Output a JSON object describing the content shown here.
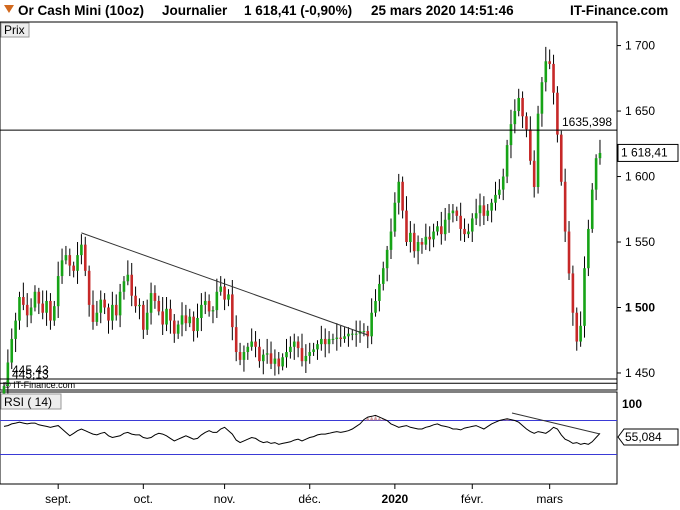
{
  "header": {
    "instrument": "Or Cash Mini (10oz)",
    "period": "Journalier",
    "quote": "1 618,41 (-0,90%)",
    "datetime": "25 mars 2020 14:51:46",
    "site": "IT-Finance.com"
  },
  "price_panel": {
    "label": "Prix",
    "copyright": "© IT-Finance.com",
    "last_value": "1 618,41",
    "resistance_value": "1635,398",
    "support_values": [
      "445,43",
      "445,13"
    ]
  },
  "rsi_panel": {
    "label": "RSI ( 14)",
    "value": "55,084",
    "upper_tick": "100"
  },
  "chart_data": [
    {
      "type": "candlestick",
      "title": "Or Cash Mini (10oz)",
      "ylabel": "Prix",
      "ylim": [
        1437,
        1718
      ],
      "y_ticks": [
        "1 700",
        "1 650",
        "1 600",
        "1 550",
        "1 500",
        "1 450"
      ],
      "y_tick_values": [
        1700,
        1650,
        1600,
        1550,
        1500,
        1450
      ],
      "bold_tick": "1 500",
      "x_labels": [
        "sept.",
        "oct.",
        "nov.",
        "déc.",
        "2020",
        "févr.",
        "mars"
      ],
      "x_label_index": [
        14,
        36,
        57,
        79,
        101,
        121,
        141
      ],
      "last": 1618.41,
      "horizontal_lines": [
        1635.398,
        1445.43,
        1445.13
      ],
      "trendline": [
        {
          "i": 20,
          "v": 1557
        },
        {
          "i": 94,
          "v": 1479
        }
      ],
      "close": [
        1440,
        1458,
        1476,
        1490,
        1508,
        1502,
        1494,
        1500,
        1512,
        1503,
        1496,
        1505,
        1490,
        1501,
        1524,
        1536,
        1540,
        1532,
        1528,
        1540,
        1548,
        1528,
        1502,
        1489,
        1496,
        1506,
        1500,
        1490,
        1502,
        1494,
        1512,
        1520,
        1525,
        1509,
        1501,
        1502,
        1483,
        1496,
        1511,
        1505,
        1497,
        1487,
        1499,
        1490,
        1480,
        1487,
        1494,
        1488,
        1493,
        1482,
        1492,
        1502,
        1505,
        1497,
        1498,
        1512,
        1516,
        1506,
        1510,
        1485,
        1466,
        1460,
        1466,
        1470,
        1474,
        1470,
        1459,
        1464,
        1465,
        1457,
        1461,
        1455,
        1462,
        1466,
        1470,
        1474,
        1469,
        1459,
        1463,
        1466,
        1468,
        1472,
        1476,
        1472,
        1476,
        1476,
        1477,
        1476,
        1478,
        1480,
        1480,
        1480,
        1482,
        1482,
        1478,
        1496,
        1505,
        1518,
        1530,
        1544,
        1558,
        1580,
        1596,
        1574,
        1550,
        1557,
        1543,
        1550,
        1548,
        1554,
        1552,
        1558,
        1562,
        1556,
        1567,
        1572,
        1574,
        1570,
        1560,
        1556,
        1558,
        1568,
        1572,
        1578,
        1570,
        1574,
        1580,
        1586,
        1590,
        1600,
        1624,
        1640,
        1650,
        1660,
        1646,
        1636,
        1612,
        1592,
        1648,
        1672,
        1688,
        1686,
        1664,
        1632,
        1596,
        1558,
        1526,
        1496,
        1474,
        1486,
        1530,
        1560,
        1590,
        1614,
        1618
      ],
      "open": [
        1430,
        1440,
        1458,
        1476,
        1490,
        1508,
        1502,
        1494,
        1500,
        1512,
        1503,
        1496,
        1505,
        1490,
        1501,
        1524,
        1536,
        1540,
        1532,
        1528,
        1540,
        1548,
        1528,
        1502,
        1489,
        1496,
        1506,
        1500,
        1490,
        1502,
        1494,
        1512,
        1520,
        1525,
        1509,
        1501,
        1502,
        1483,
        1496,
        1511,
        1505,
        1497,
        1487,
        1499,
        1490,
        1480,
        1487,
        1494,
        1488,
        1493,
        1482,
        1492,
        1502,
        1505,
        1497,
        1498,
        1512,
        1516,
        1506,
        1510,
        1485,
        1466,
        1460,
        1466,
        1470,
        1474,
        1470,
        1459,
        1464,
        1465,
        1457,
        1461,
        1455,
        1462,
        1466,
        1470,
        1474,
        1469,
        1459,
        1463,
        1466,
        1468,
        1472,
        1476,
        1472,
        1476,
        1476,
        1477,
        1476,
        1478,
        1480,
        1480,
        1480,
        1482,
        1482,
        1478,
        1496,
        1505,
        1518,
        1530,
        1544,
        1558,
        1580,
        1596,
        1574,
        1550,
        1557,
        1543,
        1550,
        1548,
        1554,
        1552,
        1558,
        1562,
        1556,
        1567,
        1572,
        1574,
        1570,
        1560,
        1556,
        1558,
        1568,
        1572,
        1578,
        1570,
        1574,
        1580,
        1586,
        1590,
        1600,
        1624,
        1640,
        1650,
        1660,
        1646,
        1636,
        1612,
        1592,
        1648,
        1672,
        1688,
        1686,
        1664,
        1632,
        1596,
        1558,
        1526,
        1496,
        1474,
        1486,
        1530,
        1560,
        1590,
        1614
      ]
    },
    {
      "type": "line",
      "title": "RSI ( 14)",
      "ylim": [
        0,
        100
      ],
      "bands": [
        70,
        30
      ],
      "values": [
        63,
        64,
        66,
        67,
        68,
        67,
        66,
        67,
        67,
        65,
        64,
        63,
        62,
        63,
        64,
        60,
        56,
        52,
        55,
        58,
        60,
        58,
        56,
        54,
        53,
        55,
        56,
        52,
        50,
        51,
        52,
        55,
        56,
        54,
        53,
        53,
        50,
        49,
        50,
        53,
        55,
        54,
        52,
        49,
        46,
        48,
        50,
        52,
        50,
        48,
        49,
        53,
        56,
        58,
        56,
        56,
        60,
        62,
        58,
        54,
        47,
        44,
        46,
        48,
        50,
        49,
        46,
        44,
        45,
        43,
        44,
        42,
        43,
        44,
        45,
        47,
        48,
        46,
        48,
        50,
        51,
        53,
        54,
        54,
        55,
        56,
        57,
        56,
        57,
        58,
        60,
        63,
        66,
        71,
        74,
        75,
        76,
        74,
        72,
        70,
        66,
        64,
        62,
        63,
        64,
        62,
        61,
        60,
        60,
        62,
        63,
        65,
        66,
        64,
        63,
        62,
        60,
        60,
        59,
        61,
        62,
        63,
        64,
        62,
        60,
        63,
        66,
        68,
        70,
        71,
        72,
        71,
        70,
        68,
        64,
        60,
        57,
        55,
        57,
        56,
        55,
        58,
        62,
        60,
        53,
        48,
        46,
        43,
        44,
        42,
        43,
        42,
        45,
        50,
        55
      ]
    }
  ]
}
